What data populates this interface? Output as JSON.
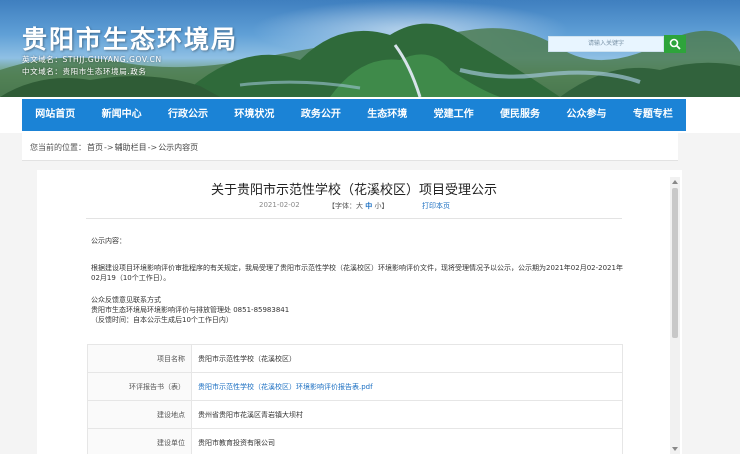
{
  "header": {
    "site_title": "贵阳市生态环境局",
    "en_domain_label": "英文域名：",
    "en_domain": "STHJJ.GUIYANG.GOV.CN",
    "cn_domain_label": "中文域名：",
    "cn_domain": "贵阳市生态环境局.政务",
    "search_placeholder": "请输入关键字",
    "search_icon": "magnifier"
  },
  "nav": {
    "items": [
      "网站首页",
      "新闻中心",
      "行政公示",
      "环境状况",
      "政务公开",
      "生态环境",
      "党建工作",
      "便民服务",
      "公众参与",
      "专题专栏"
    ]
  },
  "breadcrumb": {
    "prefix": "您当前的位置：",
    "items": [
      "首页",
      "辅助栏目",
      "公示内容页"
    ],
    "separator": "->"
  },
  "article": {
    "title": "关于贵阳市示范性学校（花溪校区）项目受理公示",
    "date": "2021-02-02",
    "font_label": "【字体：",
    "font_large": "大",
    "font_medium": "中",
    "font_small": "小",
    "font_end": "】",
    "print_label": "打印本页",
    "intro": "公示内容：",
    "paragraph": "根据建设项目环境影响评价审批程序的有关规定，我局受理了贵阳市示范性学校（花溪校区）环境影响评价文件，现将受理情况予以公示，公示期为2021年02月02-2021年02月19（10个工作日）。",
    "contact_title": "公众反馈意见联系方式",
    "contact_line": "贵阳市生态环境局环境影响评价与排放管理处 0851-85983841",
    "contact_note": "（反馈时间：自本公示生成后10个工作日内）"
  },
  "table": {
    "rows": [
      {
        "key": "项目名称",
        "value": "贵阳市示范性学校（花溪校区）"
      },
      {
        "key": "环评报告书（表）",
        "value": "贵阳市示范性学校（花溪校区）环境影响评价报告表.pdf"
      },
      {
        "key": "建设地点",
        "value": "贵州省贵阳市花溪区青岩镇大坝村"
      },
      {
        "key": "建设单位",
        "value": "贵阳市教育投资有限公司"
      }
    ]
  },
  "colors": {
    "nav_blue": "#1b83d6",
    "link_blue": "#1b6fc2",
    "search_green": "#2ea43b"
  }
}
